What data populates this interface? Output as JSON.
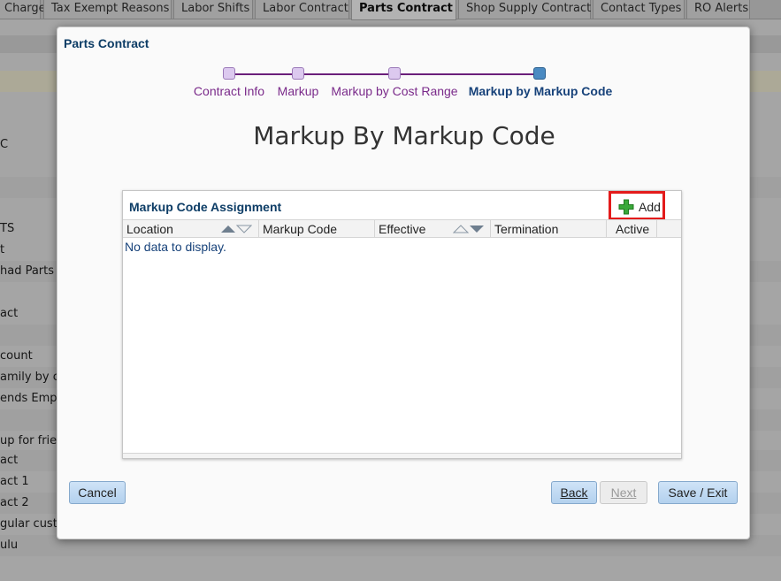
{
  "tabs": [
    {
      "label": "Charge",
      "active": false
    },
    {
      "label": "Tax Exempt Reasons",
      "active": false
    },
    {
      "label": "Labor Shifts",
      "active": false
    },
    {
      "label": "Labor Contract",
      "active": false
    },
    {
      "label": "Parts Contract",
      "active": true
    },
    {
      "label": "Shop Supply Contract",
      "active": false
    },
    {
      "label": "Contact Types",
      "active": false
    },
    {
      "label": "RO Alerts",
      "active": false
    }
  ],
  "background_rows": [
    "C",
    "TS",
    "t",
    "had Parts",
    "act",
    "count",
    "amily by co",
    "ends Emplo",
    "up for frien",
    "act",
    "act 1",
    "act 2",
    "gular custo",
    "ulu"
  ],
  "dialog": {
    "title": "Parts Contract",
    "train": [
      {
        "label": "Contract Info",
        "current": false
      },
      {
        "label": "Markup",
        "current": false
      },
      {
        "label": "Markup by Cost Range",
        "current": false
      },
      {
        "label": "Markup by Markup Code",
        "current": true
      }
    ],
    "heading": "Markup By Markup Code",
    "panel": {
      "title": "Markup Code Assignment",
      "add_label": "Add",
      "columns": [
        "Location",
        "Markup Code",
        "Effective",
        "Termination",
        "Active"
      ],
      "empty_text": "No data to display."
    },
    "buttons": {
      "cancel": "Cancel",
      "back": "Back",
      "next": "Next",
      "save_exit": "Save / Exit"
    }
  },
  "colors": {
    "train_purple": "#7a2a8a",
    "current_blue": "#17427a",
    "title_navy": "#0d3d66",
    "highlight_red": "#e31b1b",
    "add_green": "#3aa83a"
  }
}
